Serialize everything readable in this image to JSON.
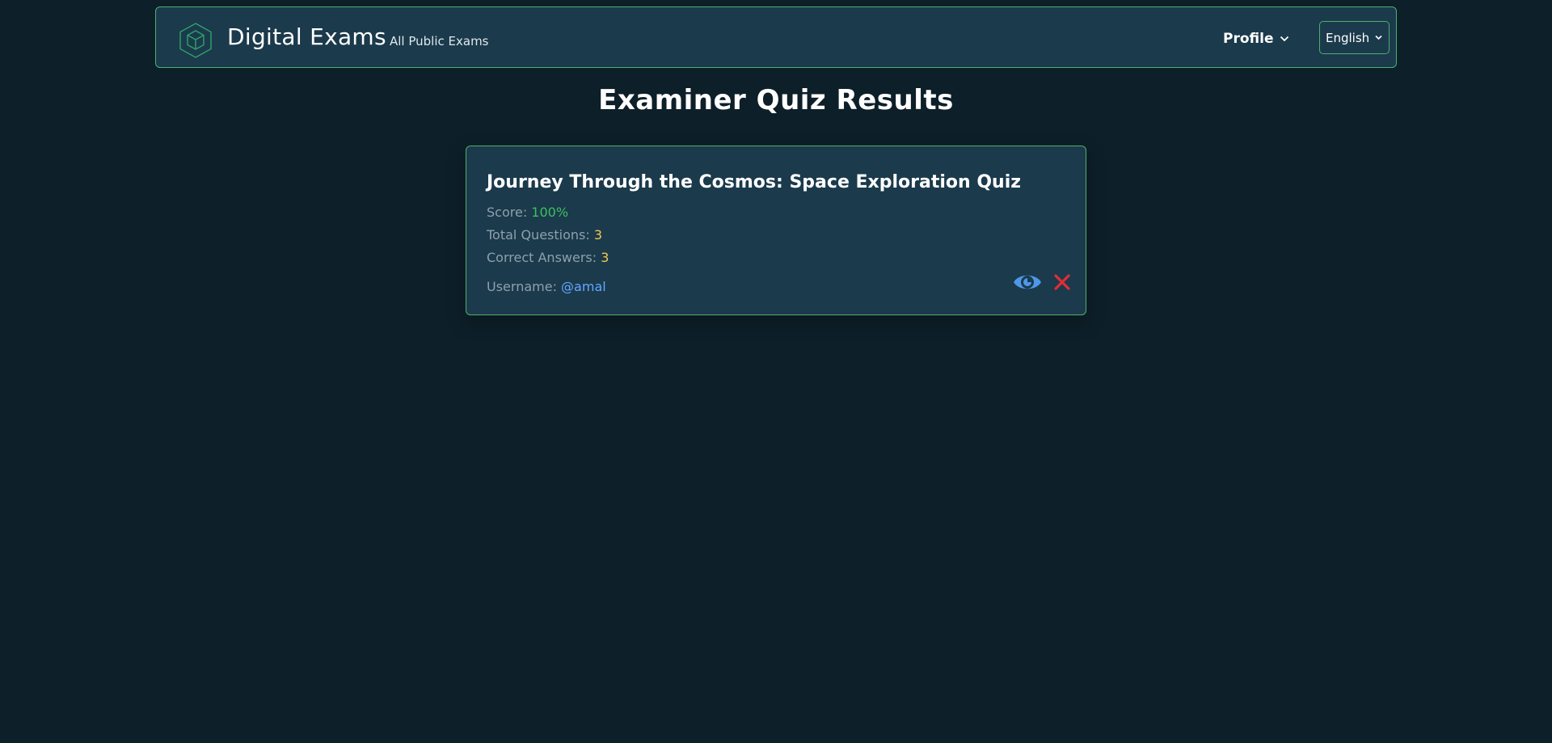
{
  "navbar": {
    "brand": "Digital Exams",
    "link": "All Public Exams",
    "profile_label": "Profile",
    "language": "English",
    "logo_icon": "hexagon-cube-icon"
  },
  "page": {
    "title": "Examiner Quiz Results"
  },
  "result": {
    "quiz_title": "Journey Through the Cosmos: Space Exploration Quiz",
    "score_label": "Score: ",
    "score_value": "100%",
    "total_label": "Total Questions: ",
    "total_value": "3",
    "correct_label": "Correct Answers: ",
    "correct_value": "3",
    "username_label": "Username: ",
    "username_value": "@amal",
    "view_icon": "eye-icon",
    "delete_icon": "close-icon"
  },
  "colors": {
    "background": "#0d1f29",
    "panel": "#1b3a4c",
    "border": "#4caf6e",
    "score": "#3fbf5f",
    "count": "#f2c94c",
    "username": "#63a6ff",
    "delete": "#e02d36"
  }
}
